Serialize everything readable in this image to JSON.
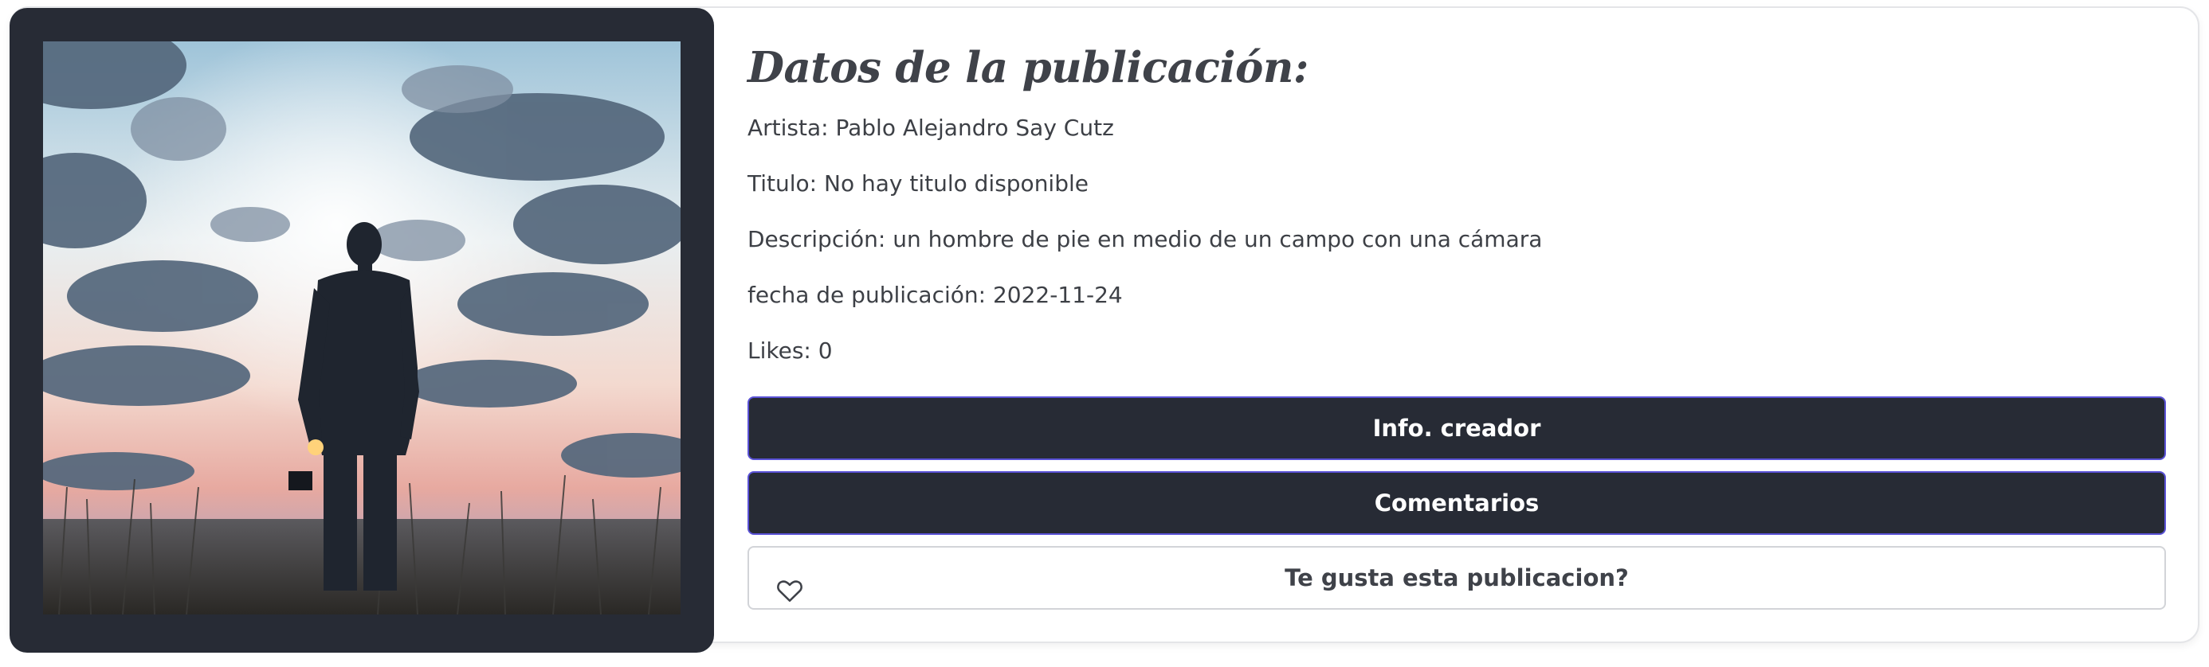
{
  "publication": {
    "heading": "Datos de la publicación:",
    "fields": [
      {
        "label": "Artista: ",
        "value": "Pablo Alejandro Say Cutz"
      },
      {
        "label": "Titulo: ",
        "value": "No hay titulo disponible"
      },
      {
        "label": "Descripción: ",
        "value": "un hombre de pie en medio de un campo con una cámara"
      },
      {
        "label": "fecha de publicación: ",
        "value": "2022-11-24"
      },
      {
        "label": "Likes: ",
        "value": "0"
      }
    ]
  },
  "buttons": {
    "info_label": "Info. creador",
    "comments_label": "Comentarios",
    "like_label": "Te gusta esta publicacion?"
  },
  "icons": {
    "like": "heart-icon"
  },
  "colors": {
    "dark": "#272b35",
    "button_border": "#5a52d6",
    "text": "#3d4046"
  }
}
